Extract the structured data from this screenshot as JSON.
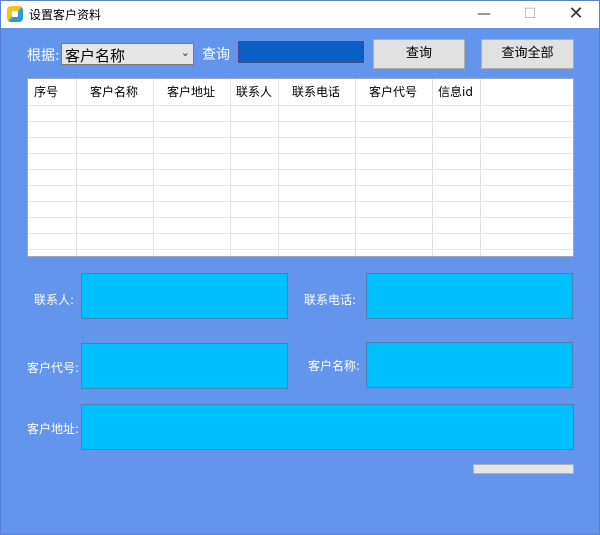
{
  "window": {
    "title": "设置客户资料"
  },
  "search": {
    "by_label": "根据:",
    "by_value": "客户名称",
    "query_label": "查询",
    "query_value": "",
    "query_button": "查询",
    "query_all_button": "查询全部"
  },
  "table": {
    "columns": [
      "序号",
      "客户名称",
      "客户地址",
      "联系人",
      "联系电话",
      "客户代号",
      "信息id"
    ]
  },
  "form": {
    "contact_label": "联系人:",
    "phone_label": "联系电话:",
    "code_label": "客户代号:",
    "name_label": "客户名称:",
    "address_label": "客户地址:"
  },
  "progress": {
    "value": 0
  },
  "colors": {
    "background": "#6495ed",
    "field": "#00bfff",
    "query_input": "#0a5fc2"
  }
}
